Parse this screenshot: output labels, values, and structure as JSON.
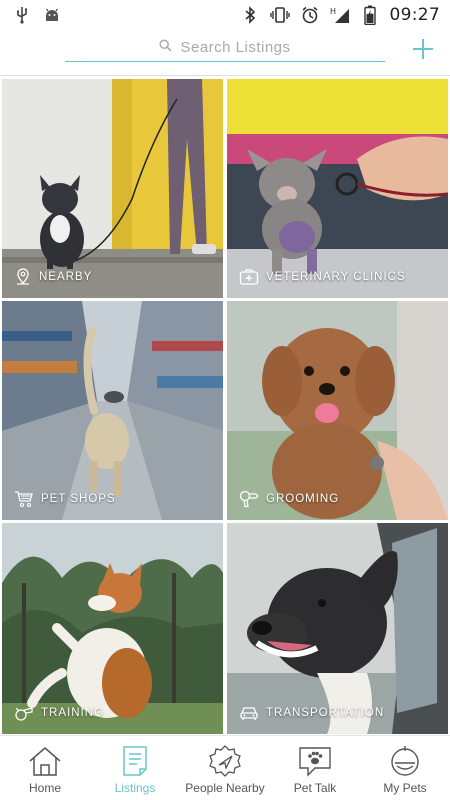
{
  "status_bar": {
    "time": "09:27",
    "icons": [
      "usb-icon",
      "android-icon",
      "bluetooth-icon",
      "vibrate-icon",
      "alarm-icon",
      "signal-icon",
      "battery-icon"
    ]
  },
  "header": {
    "search_placeholder": "Search Listings",
    "add_icon": "plus-icon"
  },
  "categories": [
    {
      "label": "NEARBY",
      "icon": "location-pin-icon"
    },
    {
      "label": "VETERINARY CLINICS",
      "icon": "medical-kit-icon"
    },
    {
      "label": "PET SHOPS",
      "icon": "shopping-cart-icon"
    },
    {
      "label": "GROOMING",
      "icon": "hair-dryer-icon"
    },
    {
      "label": "TRAINING",
      "icon": "whistle-icon"
    },
    {
      "label": "TRANSPORTATION",
      "icon": "car-icon"
    }
  ],
  "bottom_nav": {
    "items": [
      {
        "label": "Home",
        "icon": "home-icon"
      },
      {
        "label": "Listings",
        "icon": "listings-icon",
        "active": true
      },
      {
        "label": "People Nearby",
        "icon": "compass-icon"
      },
      {
        "label": "Pet Talk",
        "icon": "paw-chat-icon"
      },
      {
        "label": "My Pets",
        "icon": "pet-bowl-icon"
      }
    ]
  },
  "colors": {
    "accent": "#67c6cc",
    "nav_text": "#555555",
    "divider": "#d7e0e2"
  }
}
